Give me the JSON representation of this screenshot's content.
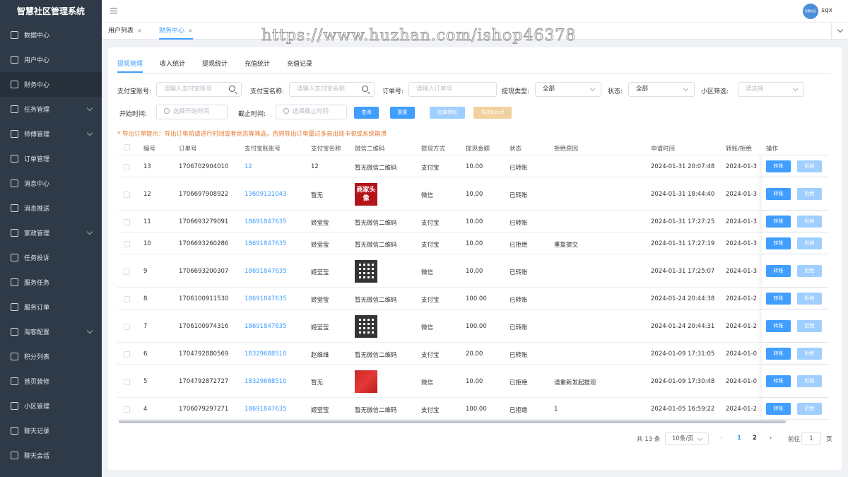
{
  "app": {
    "title": "智慧社区管理系统",
    "username": "sqx",
    "avatar_text": "智慧社区"
  },
  "watermark": "https://www.huzhan.com/ishop46378",
  "sidebar": {
    "items": [
      {
        "label": "数据中心",
        "icon": "chart-icon",
        "has_arrow": false
      },
      {
        "label": "用户中心",
        "icon": "user-icon",
        "has_arrow": false
      },
      {
        "label": "财务中心",
        "icon": "wallet-icon",
        "has_arrow": false,
        "active": true
      },
      {
        "label": "任务管理",
        "icon": "task-icon",
        "has_arrow": true
      },
      {
        "label": "师傅管理",
        "icon": "worker-icon",
        "has_arrow": true
      },
      {
        "label": "订单管理",
        "icon": "order-icon",
        "has_arrow": false
      },
      {
        "label": "消息中心",
        "icon": "message-icon",
        "has_arrow": false
      },
      {
        "label": "消息推送",
        "icon": "cloud-upload-icon",
        "has_arrow": false
      },
      {
        "label": "家政管理",
        "icon": "housekeeping-icon",
        "has_arrow": true
      },
      {
        "label": "任务投诉",
        "icon": "complaint-icon",
        "has_arrow": false
      },
      {
        "label": "服务任务",
        "icon": "service-task-icon",
        "has_arrow": false
      },
      {
        "label": "服务订单",
        "icon": "bar-chart-icon",
        "has_arrow": false
      },
      {
        "label": "淘客配置",
        "icon": "grid-icon",
        "has_arrow": true
      },
      {
        "label": "积分列表",
        "icon": "points-icon",
        "has_arrow": false
      },
      {
        "label": "首页装修",
        "icon": "box-icon",
        "has_arrow": false
      },
      {
        "label": "小区管理",
        "icon": "community-icon",
        "has_arrow": false
      },
      {
        "label": "聊天记录",
        "icon": "chat-log-icon",
        "has_arrow": false
      },
      {
        "label": "聊天会话",
        "icon": "chat-icon",
        "has_arrow": false
      }
    ]
  },
  "tabs": [
    {
      "label": "用户列表",
      "close": "×"
    },
    {
      "label": "财务中心",
      "close": "×",
      "active": true
    }
  ],
  "subtabs": [
    "提现管理",
    "收入统计",
    "提现统计",
    "充值统计",
    "充值记录"
  ],
  "filters": {
    "alipay_account": {
      "label": "支付宝账号:",
      "placeholder": "请输入支付宝账号"
    },
    "alipay_name": {
      "label": "支付宝名称:",
      "placeholder": "请输入支付宝名称"
    },
    "order_no": {
      "label": "订单号:",
      "placeholder": "请输入订单号"
    },
    "withdraw_type": {
      "label": "提现类型:",
      "value": "全部"
    },
    "status": {
      "label": "状态:",
      "value": "全部"
    },
    "community": {
      "label": "小区筛选:",
      "placeholder": "请选择"
    },
    "start_time": {
      "label": "开始时间:",
      "placeholder": "选择开始时间"
    },
    "end_time": {
      "label": "截止时间:",
      "placeholder": "选择截止时间"
    },
    "buttons": {
      "query": "查询",
      "reset": "重置",
      "batch": "批量转账",
      "export": "导出Excel"
    }
  },
  "notice": "* 导出订单提示：导出订单前请进行时间或者状态等筛选，否则导出订单量过多易出现卡顿或系统崩溃",
  "table": {
    "headers": [
      "编号",
      "订单号",
      "支付宝账账号",
      "支付宝名称",
      "微信二维码",
      "提现方式",
      "提现金额",
      "状态",
      "拒绝原因",
      "申请时间",
      "转账/拒绝",
      "操作"
    ],
    "transfer_label": "转账",
    "reject_label": "拒绝",
    "rows": [
      {
        "id": "13",
        "order": "1706702904010",
        "account": "12",
        "name": "12",
        "qr": "暂无微信二维码",
        "qr_type": "none",
        "method": "支付宝",
        "amount": "10.00",
        "status": "已转账",
        "reason": "",
        "time": "2024-01-31 20:07:48",
        "trans": "2024-01-3"
      },
      {
        "id": "12",
        "order": "1706697908922",
        "account": "13609121043",
        "name": "暂无",
        "qr": "商家头像",
        "qr_type": "logo",
        "method": "微信",
        "amount": "10.00",
        "status": "已转账",
        "reason": "",
        "time": "2024-01-31 18:44:40",
        "trans": "2024-01-3"
      },
      {
        "id": "11",
        "order": "1706693279091",
        "account": "18691847635",
        "name": "姬莹莹",
        "qr": "暂无微信二维码",
        "qr_type": "none",
        "method": "支付宝",
        "amount": "10.00",
        "status": "已转账",
        "reason": "",
        "time": "2024-01-31 17:27:25",
        "trans": "2024-01-3"
      },
      {
        "id": "10",
        "order": "1706693260286",
        "account": "18691847635",
        "name": "姬莹莹",
        "qr": "暂无微信二维码",
        "qr_type": "none",
        "method": "支付宝",
        "amount": "10.00",
        "status": "已拒绝",
        "reason": "重复提交",
        "time": "2024-01-31 17:27:19",
        "trans": "2024-01-3"
      },
      {
        "id": "9",
        "order": "1706693200307",
        "account": "18691847635",
        "name": "姬莹莹",
        "qr": "",
        "qr_type": "qr",
        "method": "微信",
        "amount": "10.00",
        "status": "已转账",
        "reason": "",
        "time": "2024-01-31 17:25:07",
        "trans": "2024-01-3"
      },
      {
        "id": "8",
        "order": "1706100911530",
        "account": "18691847635",
        "name": "姬莹莹",
        "qr": "暂无微信二维码",
        "qr_type": "none",
        "method": "支付宝",
        "amount": "100.00",
        "status": "已转账",
        "reason": "",
        "time": "2024-01-24 20:44:38",
        "trans": "2024-01-2"
      },
      {
        "id": "7",
        "order": "1706100974316",
        "account": "18691847635",
        "name": "姬莹莹",
        "qr": "",
        "qr_type": "qr",
        "method": "微信",
        "amount": "100.00",
        "status": "已转账",
        "reason": "",
        "time": "2024-01-24 20:44:31",
        "trans": "2024-01-2"
      },
      {
        "id": "6",
        "order": "1704792880569",
        "account": "18329688510",
        "name": "赵维维",
        "qr": "暂无微信二维码",
        "qr_type": "none",
        "method": "支付宝",
        "amount": "20.00",
        "status": "已转账",
        "reason": "",
        "time": "2024-01-09 17:31:05",
        "trans": "2024-01-0"
      },
      {
        "id": "5",
        "order": "1704792872727",
        "account": "18329688510",
        "name": "暂无",
        "qr": "",
        "qr_type": "photo",
        "method": "微信",
        "amount": "10.00",
        "status": "已拒绝",
        "reason": "请重新发起提现",
        "time": "2024-01-09 17:30:48",
        "trans": "2024-01-0"
      },
      {
        "id": "4",
        "order": "1706079297271",
        "account": "18691847635",
        "name": "姬莹莹",
        "qr": "暂无微信二维码",
        "qr_type": "none",
        "method": "支付宝",
        "amount": "100.00",
        "status": "已拒绝",
        "reason": "1",
        "time": "2024-01-05 16:59:22",
        "trans": "2024-01-2"
      }
    ]
  },
  "pagination": {
    "total": "共 13 条",
    "page_size": "10条/页",
    "pages": [
      "1",
      "2"
    ],
    "current": "1",
    "goto_label": "前往",
    "goto_value": "1",
    "page_suffix": "页",
    "prev": "‹",
    "next": "›"
  },
  "colors": {
    "sidebar_bg": "#2e3a47",
    "accent": "#409eff",
    "notice": "#e6762b"
  }
}
